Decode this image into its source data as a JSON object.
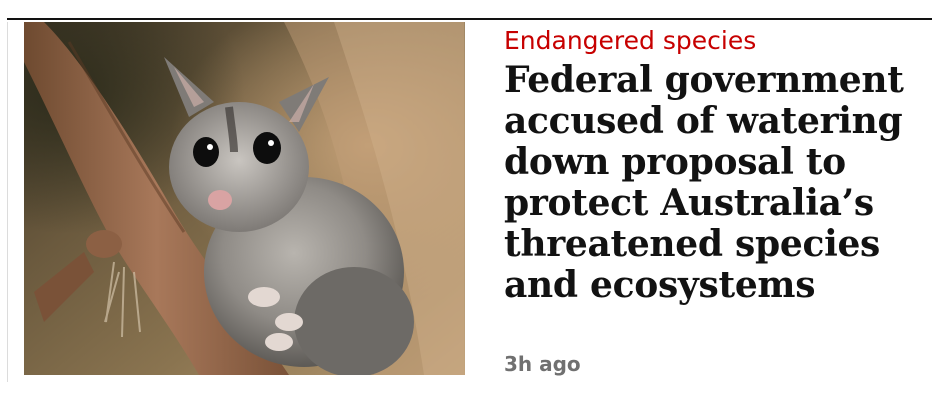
{
  "article": {
    "kicker": "Endangered species",
    "headline": "Federal government accused of watering down proposal to protect Australia’s threatened species and ecosystems",
    "timestamp": "3h ago"
  },
  "image": {
    "subject": "possum-photo"
  },
  "colors": {
    "kicker": "#c70000",
    "headline": "#121212",
    "timestamp": "#707070",
    "rule": "#121212"
  }
}
